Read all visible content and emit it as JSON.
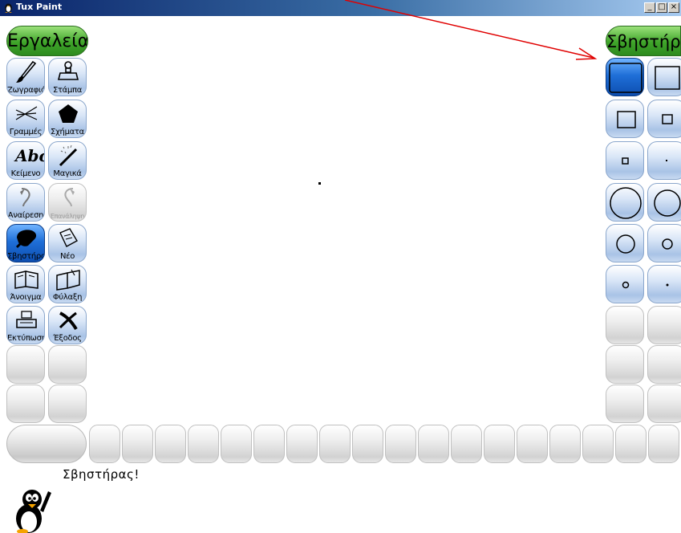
{
  "window": {
    "title": "Tux Paint",
    "minimize": "_",
    "maximize": "□",
    "close": "×"
  },
  "tools_header": "Εργαλεία",
  "erasers_header": "Σβηστήρες",
  "tools": [
    {
      "label": "Ζωγραφιά",
      "icon": "paintbrush-icon"
    },
    {
      "label": "Στάμπα",
      "icon": "stamp-icon"
    },
    {
      "label": "Γραμμές",
      "icon": "lines-icon"
    },
    {
      "label": "Σχήματα",
      "icon": "shapes-icon"
    },
    {
      "label": "Κείμενο",
      "icon": "text-icon",
      "icon_text": "Abc"
    },
    {
      "label": "Μαγικά",
      "icon": "magic-wand-icon"
    },
    {
      "label": "Αναίρεση",
      "icon": "undo-icon"
    },
    {
      "label": "Επανάληψη",
      "icon": "redo-icon"
    },
    {
      "label": "Σβηστήρας",
      "icon": "eraser-icon",
      "selected": true
    },
    {
      "label": "Νέο",
      "icon": "new-page-icon"
    },
    {
      "label": "Άνοιγμα",
      "icon": "open-book-icon"
    },
    {
      "label": "Φύλαξη",
      "icon": "save-book-icon"
    },
    {
      "label": "Εκτύπωση",
      "icon": "printer-icon"
    },
    {
      "label": "Έξοδος",
      "icon": "quit-icon"
    }
  ],
  "erasers": [
    {
      "shape": "square",
      "size": "xl",
      "selected": true
    },
    {
      "shape": "square",
      "size": "lg"
    },
    {
      "shape": "square",
      "size": "md"
    },
    {
      "shape": "square",
      "size": "sm"
    },
    {
      "shape": "square",
      "size": "xs"
    },
    {
      "shape": "square",
      "size": "dot"
    },
    {
      "shape": "circle",
      "size": "xl"
    },
    {
      "shape": "circle",
      "size": "lg"
    },
    {
      "shape": "circle",
      "size": "md"
    },
    {
      "shape": "circle",
      "size": "sm"
    },
    {
      "shape": "circle",
      "size": "xs"
    },
    {
      "shape": "circle",
      "size": "dot"
    }
  ],
  "tip": "Σβηστήρας!",
  "colors": {
    "accent_green": "#3fa52a",
    "selected_blue": "#1f6fd8",
    "annotation_arrow": "#e00000"
  }
}
